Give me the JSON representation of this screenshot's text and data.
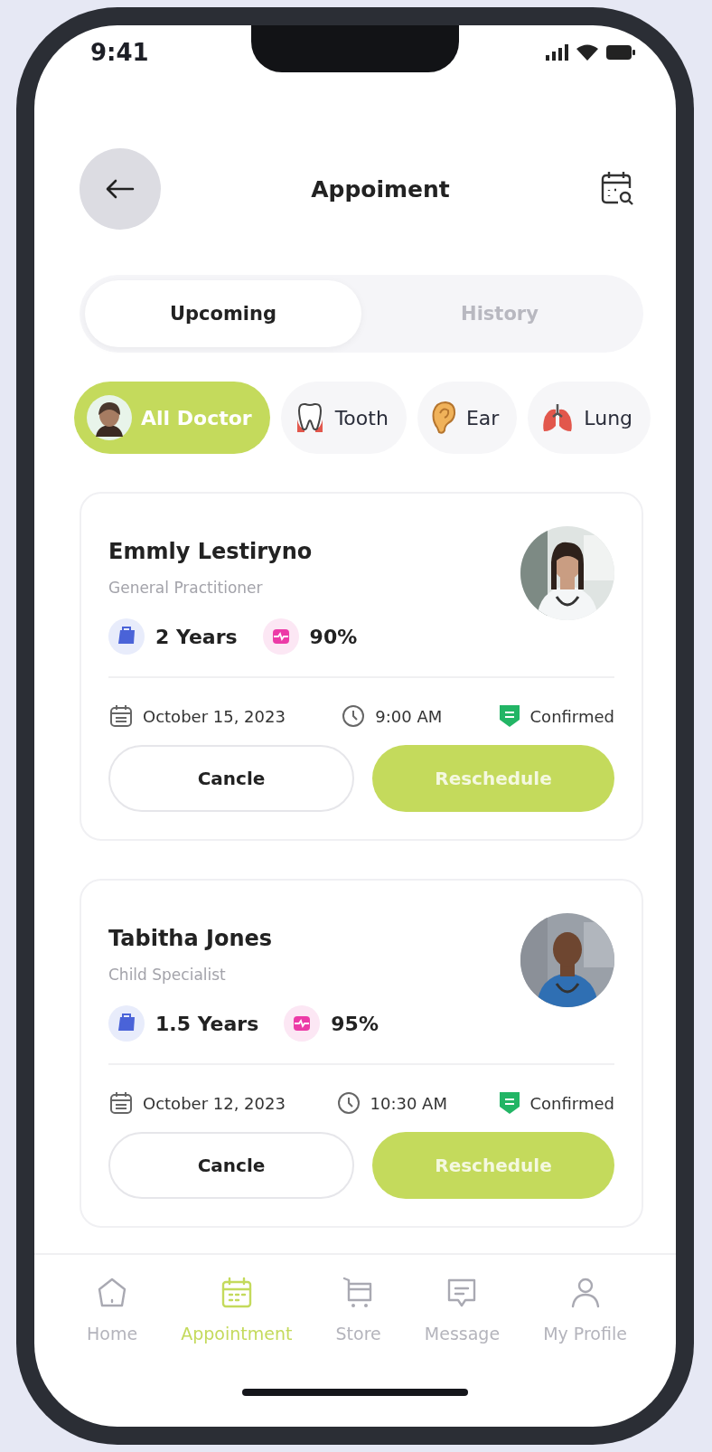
{
  "status_bar": {
    "time": "9:41"
  },
  "header": {
    "title": "Appoiment"
  },
  "tabs": [
    {
      "label": "Upcoming",
      "selected": true
    },
    {
      "label": "History",
      "selected": false
    }
  ],
  "filters": [
    {
      "label": "All Doctor",
      "kind": "avatar",
      "selected": true
    },
    {
      "label": "Tooth",
      "kind": "tooth",
      "selected": false
    },
    {
      "label": "Ear",
      "kind": "ear",
      "selected": false
    },
    {
      "label": "Lung",
      "kind": "lungs",
      "selected": false
    }
  ],
  "appointments": [
    {
      "name": "Emmly Lestiryno",
      "specialty": "General Practitioner",
      "experience": "2 Years",
      "rating": "90%",
      "date": "October 15, 2023",
      "time": "9:00 AM",
      "status": "Confirmed",
      "secondary_action": "Cancle",
      "primary_action": "Reschedule"
    },
    {
      "name": "Tabitha Jones",
      "specialty": "Child Specialist",
      "experience": "1.5 Years",
      "rating": "95%",
      "date": "October 12, 2023",
      "time": "10:30 AM",
      "status": "Confirmed",
      "secondary_action": "Cancle",
      "primary_action": "Reschedule"
    }
  ],
  "nav": [
    {
      "label": "Home",
      "kind": "home",
      "selected": false
    },
    {
      "label": "Appointment",
      "kind": "calendar",
      "selected": true
    },
    {
      "label": "Store",
      "kind": "cart",
      "selected": false
    },
    {
      "label": "Message",
      "kind": "message",
      "selected": false
    },
    {
      "label": "My Profile",
      "kind": "profile",
      "selected": false
    }
  ]
}
